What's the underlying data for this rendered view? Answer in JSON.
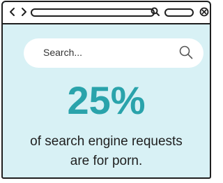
{
  "browser": {
    "icons": {
      "back": "chevron-left-icon",
      "forward": "chevron-right-icon",
      "search": "search-icon",
      "close": "close-icon"
    }
  },
  "search": {
    "placeholder": "Search..."
  },
  "stat": {
    "value": "25%",
    "caption_line1": "of search engine requests",
    "caption_line2": "are for porn."
  },
  "colors": {
    "background": "#d8f1f5",
    "accent": "#2aa3ab",
    "outline": "#1f1f1f"
  }
}
